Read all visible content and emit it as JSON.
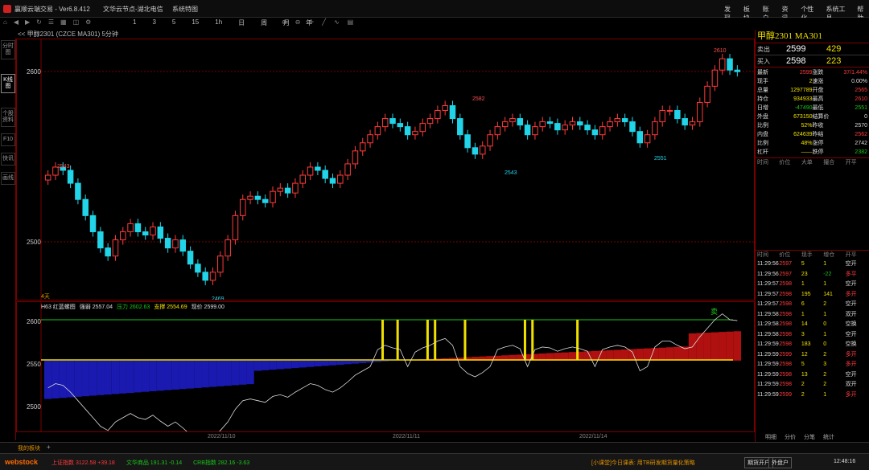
{
  "window": {
    "title": "赢顺云端交易 - Ver6.8.412",
    "center_title": "文华云节点-湖北电信",
    "menu_label": "系统特图",
    "menus": [
      "发现",
      "板块",
      "账户",
      "资讯",
      "个性化",
      "系统工具",
      "帮助"
    ]
  },
  "toolbar": [
    "1",
    "3",
    "5",
    "15",
    "1h",
    "日",
    "周",
    "月",
    "年"
  ],
  "left_tabs": [
    "分时图",
    "K线图",
    "个股资料",
    "F10",
    "快讯",
    "画线"
  ],
  "chart_header": "<< 甲醇2301 (CZCE MA301) 5分钟",
  "main_chart": {
    "y_ticks": [
      "2600",
      "2500"
    ],
    "annotations": [
      "2543",
      "2582",
      "2610",
      "2469",
      "2543",
      "2551"
    ],
    "bottom_label": "4天",
    "ylim": [
      2460,
      2615
    ]
  },
  "sub_chart": {
    "indicator_name": "H63 红蓝螺图",
    "values_text": [
      {
        "label": "强弱",
        "value": "2557.04"
      },
      {
        "label": "压力",
        "value": "2602.63"
      },
      {
        "label": "支撑",
        "value": "2554.69"
      },
      {
        "label": "现价",
        "value": "2599.00"
      }
    ],
    "y_ticks": [
      "2600",
      "2550",
      "2500"
    ],
    "signal_label": "卖"
  },
  "x_axis": [
    "2022/11/10",
    "2022/11/11",
    "2022/11/14"
  ],
  "quote": {
    "title": "甲醇2301 MA301",
    "ask_label": "卖出",
    "ask_price": "2599",
    "ask_vol": "429",
    "bid_label": "买入",
    "bid_price": "2598",
    "bid_vol": "223",
    "rows": [
      [
        "最新",
        "2599",
        "涨跌",
        "37/1.44%"
      ],
      [
        "现手",
        "2",
        "速涨",
        "0.00%"
      ],
      [
        "总量",
        "1297789",
        "开盘",
        "2565"
      ],
      [
        "持仓",
        "934933",
        "最高",
        "2610"
      ],
      [
        "日增",
        "-47490",
        "最低",
        "2551"
      ],
      [
        "外盘",
        "673150",
        "结算价",
        "0"
      ],
      [
        "比例",
        "52%",
        "昨收",
        "2570"
      ],
      [
        "内盘",
        "624639",
        "昨结",
        "2562"
      ],
      [
        "比例",
        "48%",
        "涨停",
        "2742"
      ],
      [
        "杠杆",
        "——",
        "跌停",
        "2382"
      ]
    ],
    "ticks_header_top": [
      "时间",
      "价位",
      "大单",
      "撮合",
      "开平"
    ],
    "ticks_header": [
      "时间",
      "价位",
      "现手",
      "增仓",
      "开平"
    ],
    "ticks": [
      [
        "11:29:56",
        "2597",
        "5",
        "1",
        "空开"
      ],
      [
        "11:29:56",
        "2597",
        "23",
        "-22",
        "多平"
      ],
      [
        "11:29:57",
        "2598",
        "1",
        "1",
        "空开"
      ],
      [
        "11:29:57",
        "2598",
        "195",
        "141",
        "多开"
      ],
      [
        "11:29:57",
        "2598",
        "6",
        "2",
        "空开"
      ],
      [
        "11:29:58",
        "2598",
        "1",
        "1",
        "双开"
      ],
      [
        "11:29:58",
        "2598",
        "14",
        "0",
        "空换"
      ],
      [
        "11:29:58",
        "2598",
        "3",
        "1",
        "空开"
      ],
      [
        "11:29:59",
        "2598",
        "183",
        "0",
        "空换"
      ],
      [
        "11:29:59",
        "2599",
        "12",
        "2",
        "多开"
      ],
      [
        "11:29:59",
        "2598",
        "5",
        "3",
        "多开"
      ],
      [
        "11:29:59",
        "2598",
        "13",
        "2",
        "空开"
      ],
      [
        "11:29:59",
        "2598",
        "2",
        "2",
        "双开"
      ],
      [
        "11:29:59",
        "2599",
        "2",
        "1",
        "多开"
      ]
    ],
    "bottom_tabs": [
      "明细",
      "分价",
      "分笔",
      "统计"
    ]
  },
  "bottom_tabs": [
    "我的板块",
    "+"
  ],
  "status": {
    "logo": "webstock",
    "indices": [
      {
        "name": "上证指数",
        "value": "3122.58",
        "change": "+39.18"
      },
      {
        "name": "文华商品",
        "value": "191.31",
        "change": "-0.14"
      },
      {
        "name": "CRB指数",
        "value": "282.16",
        "change": "-3.63"
      }
    ],
    "news": "[小课堂]今日课表: 用TB研发期货量化策略",
    "buttons": [
      "期货开户",
      "外盘户"
    ],
    "time": "12:48:16"
  },
  "chart_data": {
    "type": "candlestick",
    "ylim": [
      2460,
      2615
    ],
    "x_labels": [
      "2022/11/10",
      "2022/11/11",
      "2022/11/14"
    ],
    "series_close": [
      2535,
      2540,
      2538,
      2530,
      2520,
      2510,
      2500,
      2490,
      2485,
      2495,
      2500,
      2505,
      2500,
      2498,
      2503,
      2496,
      2490,
      2495,
      2488,
      2480,
      2475,
      2470,
      2475,
      2485,
      2495,
      2510,
      2520,
      2522,
      2520,
      2518,
      2525,
      2527,
      2524,
      2530,
      2535,
      2540,
      2538,
      2533,
      2530,
      2535,
      2542,
      2550,
      2555,
      2560,
      2565,
      2570,
      2567,
      2565,
      2560,
      2562,
      2567,
      2570,
      2575,
      2578,
      2570,
      2560,
      2552,
      2548,
      2553,
      2560,
      2565,
      2568,
      2570,
      2566,
      2560,
      2565,
      2568,
      2567,
      2563,
      2566,
      2568,
      2566,
      2563,
      2560,
      2565,
      2568,
      2570,
      2568,
      2562,
      2555,
      2560,
      2568,
      2575,
      2575,
      2570,
      2566,
      2568,
      2580,
      2590,
      2600,
      2607,
      2600,
      2599
    ]
  }
}
